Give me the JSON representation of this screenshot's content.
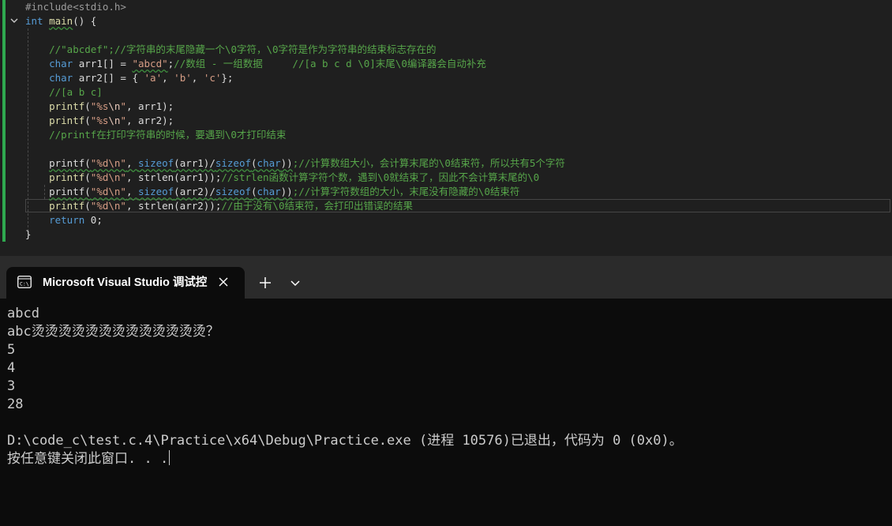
{
  "editor": {
    "lines": [
      [
        {
          "t": "#include<stdio.h>",
          "c": "pp"
        }
      ],
      [
        {
          "t": "int",
          "c": "kw"
        },
        {
          "t": " "
        },
        {
          "t": "main",
          "c": "fn sq"
        },
        {
          "t": "() {"
        }
      ],
      [],
      [
        {
          "t": "    //\"abcdef\";//字符串的末尾隐藏一个\\0字符，\\0字符是作为字符串的结束标志存在的",
          "c": "cmt"
        }
      ],
      [
        {
          "t": "    "
        },
        {
          "t": "char",
          "c": "kw"
        },
        {
          "t": " arr1[] = "
        },
        {
          "t": "\"abcd\"",
          "c": "str sq"
        },
        {
          "t": ";"
        },
        {
          "t": "//数组 - 一组数据     //[a b c d \\0]末尾\\0编译器会自动补充",
          "c": "cmt"
        }
      ],
      [
        {
          "t": "    "
        },
        {
          "t": "char",
          "c": "kw"
        },
        {
          "t": " arr2[] = { "
        },
        {
          "t": "'a'",
          "c": "str"
        },
        {
          "t": ", "
        },
        {
          "t": "'b'",
          "c": "str"
        },
        {
          "t": ", "
        },
        {
          "t": "'c'",
          "c": "str"
        },
        {
          "t": "};"
        }
      ],
      [
        {
          "t": "    //[a b c]",
          "c": "cmt"
        }
      ],
      [
        {
          "t": "    "
        },
        {
          "t": "printf",
          "c": "fn"
        },
        {
          "t": "("
        },
        {
          "t": "\"%s",
          "c": "str"
        },
        {
          "t": "\\n",
          "c": "esc"
        },
        {
          "t": "\"",
          "c": "str"
        },
        {
          "t": ", arr1);"
        }
      ],
      [
        {
          "t": "    "
        },
        {
          "t": "printf",
          "c": "fn"
        },
        {
          "t": "("
        },
        {
          "t": "\"%s",
          "c": "str"
        },
        {
          "t": "\\n",
          "c": "esc"
        },
        {
          "t": "\"",
          "c": "str"
        },
        {
          "t": ", arr2);"
        }
      ],
      [
        {
          "t": "    //printf在打印字符串的时候，要遇到\\0才打印结束",
          "c": "cmt"
        }
      ],
      [],
      [
        {
          "t": "    "
        },
        {
          "t": "printf(",
          "c": "sq"
        },
        {
          "t": "\"%d\\n\"",
          "c": "str sq"
        },
        {
          "t": ", ",
          "c": "sq"
        },
        {
          "t": "sizeof",
          "c": "kw sq"
        },
        {
          "t": "(arr1)/",
          "c": "sq"
        },
        {
          "t": "sizeof",
          "c": "kw sq"
        },
        {
          "t": "(",
          "c": "sq"
        },
        {
          "t": "char",
          "c": "kw sq"
        },
        {
          "t": "))",
          "c": "sq"
        },
        {
          "t": ";//计算数组大小，会计算末尾的\\0结束符，所以共有5个字符",
          "c": "cmt"
        }
      ],
      [
        {
          "t": "    "
        },
        {
          "t": "printf",
          "c": "fn"
        },
        {
          "t": "("
        },
        {
          "t": "\"%d\\n\"",
          "c": "str"
        },
        {
          "t": ", strlen(arr1));"
        },
        {
          "t": "//strlen函数计算字符个数，遇到\\0就结束了，因此不会计算末尾的\\0",
          "c": "cmt"
        }
      ],
      [
        {
          "t": "    "
        },
        {
          "t": "printf(",
          "c": "sq"
        },
        {
          "t": "\"%d\\n\"",
          "c": "str sq"
        },
        {
          "t": ", ",
          "c": "sq"
        },
        {
          "t": "sizeof",
          "c": "kw sq"
        },
        {
          "t": "(arr2)/",
          "c": "sq"
        },
        {
          "t": "sizeof",
          "c": "kw sq"
        },
        {
          "t": "(",
          "c": "sq"
        },
        {
          "t": "char",
          "c": "kw sq"
        },
        {
          "t": "))",
          "c": "sq"
        },
        {
          "t": ";//计算字符数组的大小，末尾没有隐藏的\\0结束符",
          "c": "cmt"
        }
      ],
      [
        {
          "t": "    "
        },
        {
          "t": "printf",
          "c": "fn"
        },
        {
          "t": "("
        },
        {
          "t": "\"%d\\n\"",
          "c": "str"
        },
        {
          "t": ", strlen(arr2));"
        },
        {
          "t": "//由于没有\\0结束符，会打印出错误的结果",
          "c": "cmt"
        }
      ],
      [
        {
          "t": "    "
        },
        {
          "t": "return",
          "c": "kw"
        },
        {
          "t": " 0;"
        }
      ],
      [
        {
          "t": "}"
        }
      ]
    ]
  },
  "terminal": {
    "tab_title": "Microsoft Visual Studio 调试控",
    "output": [
      "abcd",
      "abc烫烫烫烫烫烫烫烫烫烫烫烫烫？",
      "5",
      "4",
      "3",
      "28",
      "",
      "D:\\code_c\\test.c.4\\Practice\\x64\\Debug\\Practice.exe (进程 10576)已退出，代码为 0 (0x0)。",
      "按任意键关闭此窗口. . ."
    ]
  },
  "icons": {
    "fold": "chevron-down-icon",
    "tab": "terminal-app-icon",
    "close": "close-icon",
    "new_tab": "plus-icon",
    "tab_menu": "chevron-down-icon"
  },
  "colors": {
    "editor_bg": "#1f1f1f",
    "terminal_bg": "#0c0c0c",
    "tabstrip_bg": "#2b2b2b",
    "change_bar": "#2fa84f",
    "keyword": "#569cd6",
    "string": "#d69d85",
    "comment": "#57a64a",
    "function": "#dcdcaa"
  }
}
